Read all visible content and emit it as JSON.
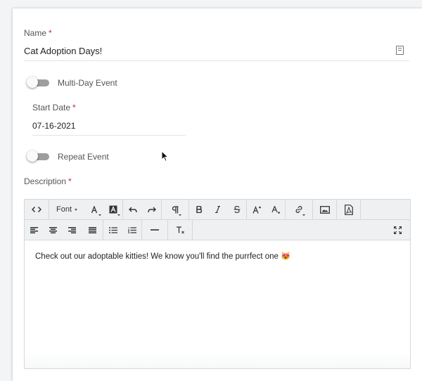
{
  "form": {
    "name": {
      "label": "Name",
      "required_mark": "*",
      "value": "Cat Adoption Days!",
      "icon": "contact-card-icon"
    },
    "multi_day": {
      "label": "Multi-Day Event",
      "checked": false
    },
    "start_date": {
      "label": "Start Date",
      "required_mark": "*",
      "value": "07-16-2021"
    },
    "repeat": {
      "label": "Repeat Event",
      "checked": false
    },
    "description": {
      "label": "Description",
      "required_mark": "*",
      "toolbar": {
        "font_label": "Font",
        "buttons_row1": [
          "code-view-icon",
          "font-family",
          "text-color-icon",
          "background-color-icon",
          "undo-icon",
          "redo-icon",
          "paragraph-format-icon",
          "bold-icon",
          "italic-icon",
          "strikethrough-icon",
          "superscript-icon",
          "subscript-icon",
          "insert-link-icon",
          "insert-image-icon",
          "insert-pdf-icon"
        ],
        "buttons_row2": [
          "align-left-icon",
          "align-center-icon",
          "align-right-icon",
          "align-justify-icon",
          "bulleted-list-icon",
          "numbered-list-icon",
          "horizontal-rule-icon",
          "clear-formatting-icon",
          "fullscreen-icon"
        ]
      },
      "content": "Check out our adoptable kitties! We know you'll find the purrfect one 😻"
    }
  },
  "colors": {
    "required": "#c62828",
    "toggle_off_track": "#9e9e9e",
    "toolbar_bg": "#eef0f2",
    "page_bg": "#f3f4f5"
  }
}
